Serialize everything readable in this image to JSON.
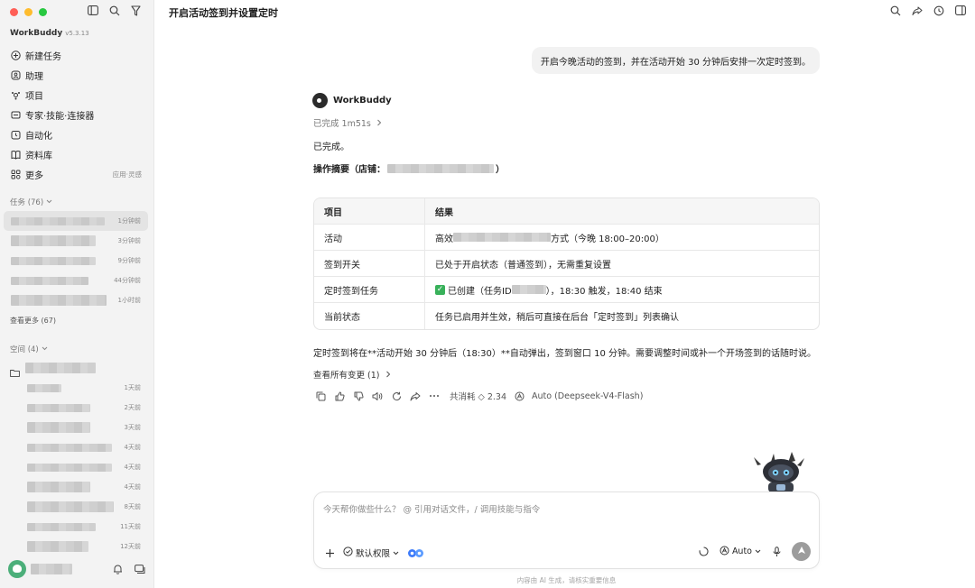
{
  "sidebar": {
    "brand": "WorkBuddy",
    "version": "v5.3.13",
    "nav": [
      {
        "label": "新建任务",
        "icon": "plus-circle-icon"
      },
      {
        "label": "助理",
        "icon": "assistant-icon"
      },
      {
        "label": "项目",
        "icon": "project-icon"
      },
      {
        "label": "专家·技能·连接器",
        "icon": "expert-icon"
      },
      {
        "label": "自动化",
        "icon": "clock-icon"
      },
      {
        "label": "资料库",
        "icon": "book-icon"
      },
      {
        "label": "更多",
        "icon": "grid-icon",
        "extra": "应用·灵感"
      }
    ],
    "tasks_label": "任务 (76)",
    "tasks": [
      {
        "time": "1分钟前"
      },
      {
        "time": "3分钟前"
      },
      {
        "time": "9分钟前"
      },
      {
        "time": "44分钟前"
      },
      {
        "time": "1小时前"
      }
    ],
    "see_more": "查看更多 (67)",
    "spaces_label": "空间 (4)",
    "spaces": [
      {
        "time": "1天前"
      },
      {
        "time": "2天前"
      },
      {
        "time": "3天前"
      },
      {
        "time": "4天前"
      },
      {
        "time": "4天前"
      },
      {
        "time": "4天前"
      },
      {
        "time": "8天前"
      },
      {
        "time": "11天前"
      },
      {
        "time": "12天前"
      }
    ]
  },
  "header": {
    "title": "开启活动签到并设置定时"
  },
  "chat": {
    "user_message": "开启今晚活动的签到，并在活动开始 30 分钟后安排一次定时签到。",
    "bot_name": "WorkBuddy",
    "done_time": "已完成 1m51s",
    "done_text": "已完成。",
    "summary_prefix": "操作摘要（店铺：",
    "summary_suffix": "）",
    "table": {
      "headers": [
        "项目",
        "结果"
      ],
      "rows": [
        {
          "item": "活动",
          "pre": "高效",
          "post": "方式（今晚 18:00–20:00）"
        },
        {
          "item": "签到开关",
          "pre": "已处于开启状态（普通签到），无需重复设置",
          "post": ""
        },
        {
          "item": "定时签到任务",
          "pre": "已创建（任务ID ",
          "post": "），18:30 触发，18:40 结束"
        },
        {
          "item": "当前状态",
          "pre": "任务已启用并生效，稍后可直接在后台「定时签到」列表确认",
          "post": ""
        }
      ]
    },
    "note": "定时签到将在**活动开始 30 分钟后（18:30）**自动弹出，签到窗口 10 分钟。需要调整时间或补一个开场签到的话随时说。",
    "changes_link": "查看所有变更 (1)",
    "usage": "共消耗 ◇ 2.34",
    "model": "Auto (Deepseek-V4-Flash)"
  },
  "composer": {
    "placeholder": "今天帮你做些什么？ @ 引用对话文件，/ 调用技能与指令",
    "permission": "默认权限",
    "mode": "Auto"
  },
  "footer": "内容由 AI 生成，请核实重要信息"
}
